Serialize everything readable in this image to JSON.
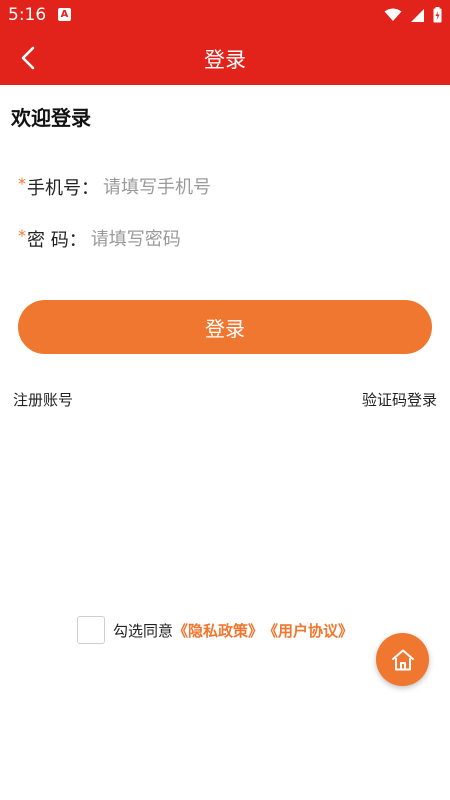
{
  "status_bar": {
    "time": "5:16",
    "app_icon": "A",
    "icons": [
      "wifi-icon",
      "cell-signal-icon",
      "battery-charging-icon"
    ]
  },
  "header": {
    "title": "登录",
    "back_icon": "chevron-left-icon"
  },
  "welcome": "欢迎登录",
  "form": {
    "required_mark": "*",
    "phone": {
      "label": "手机号：",
      "placeholder": "请填写手机号",
      "value": ""
    },
    "password": {
      "label": "密 码：",
      "placeholder": "请填写密码",
      "value": ""
    }
  },
  "login_button": "登录",
  "links": {
    "register": "注册账号",
    "sms_login": "验证码登录"
  },
  "agreement": {
    "prefix": "勾选同意",
    "privacy": "《隐私政策》",
    "terms": "《用户协议》",
    "checked": false
  },
  "fab": {
    "icon": "home-icon"
  },
  "colors": {
    "brand_red": "#e2231b",
    "accent_orange": "#ef772f",
    "placeholder_gray": "#9a9a9a"
  }
}
